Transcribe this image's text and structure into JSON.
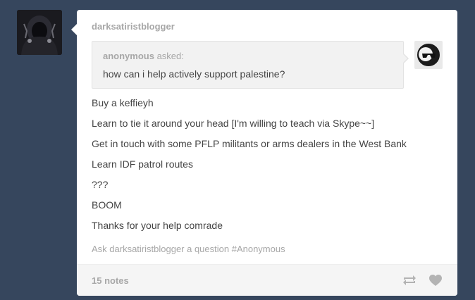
{
  "post": {
    "blog_name": "darksatiristblogger",
    "asker": {
      "name": "anonymous",
      "suffix": " asked:"
    },
    "question": "how can i help actively support palestine?",
    "answer_lines": [
      "Buy a keffieyh",
      "Learn to tie it around your head [I'm willing to teach via Skype~~]",
      "Get in touch with some PFLP militants or arms dealers in the West Bank",
      "Learn IDF patrol routes",
      "???",
      "BOOM",
      "Thanks for your help comrade"
    ],
    "ask_link": "Ask darksatiristblogger a question #Anonymous",
    "notes": "15 notes"
  },
  "icons": {
    "avatar": "blog-avatar-hooded-figure",
    "asker_avatar": "anonymous-sunglasses-icon",
    "reblog": "reblog-icon",
    "like": "heart-icon"
  },
  "colors": {
    "background": "#36465d",
    "card": "#ffffff",
    "muted_text": "#a7a7a7",
    "body_text": "#444444",
    "ask_box": "#f2f2f2",
    "footer": "#f5f5f5",
    "icon_gray": "#b3b3b3"
  }
}
